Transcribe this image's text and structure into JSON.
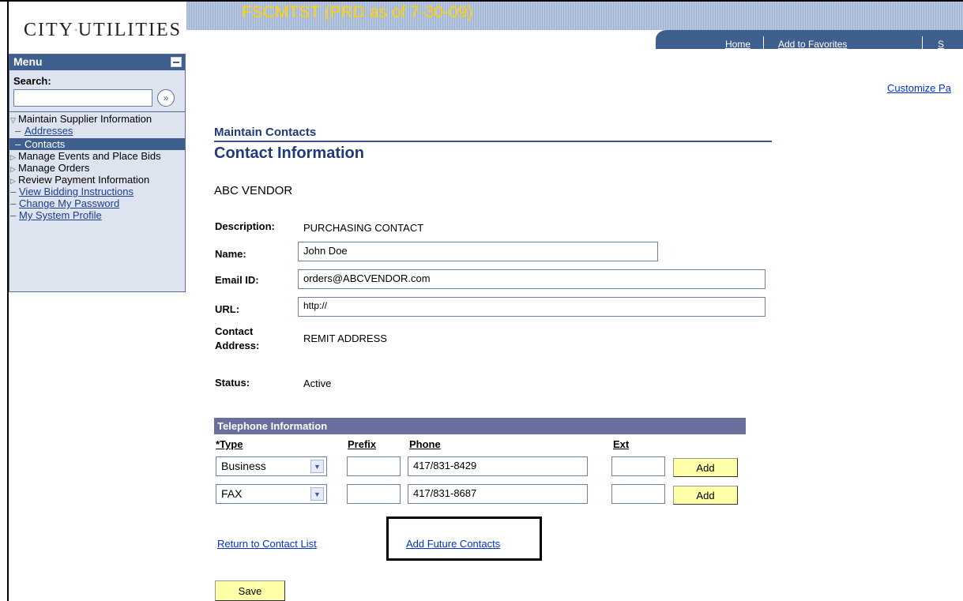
{
  "app": {
    "logo_left": "CITY",
    "logo_right": "UTILITIES",
    "banner_title": "FSCMTST (PRD as of 7-30-09)"
  },
  "nav": {
    "home": "Home",
    "add_favorites": "Add to Favorites"
  },
  "menu": {
    "title": "Menu",
    "search_label": "Search:",
    "search_value": "",
    "items": [
      {
        "label": "Maintain Supplier Information",
        "type": "expanded"
      },
      {
        "label": "Addresses",
        "type": "sub-link"
      },
      {
        "label": "Contacts",
        "type": "sub-active"
      },
      {
        "label": "Manage Events and Place Bids",
        "type": "collapsed"
      },
      {
        "label": "Manage Orders",
        "type": "collapsed"
      },
      {
        "label": "Review Payment Information",
        "type": "collapsed"
      },
      {
        "label": "View Bidding Instructions",
        "type": "link"
      },
      {
        "label": "Change My Password",
        "type": "link"
      },
      {
        "label": "My System Profile",
        "type": "link"
      }
    ]
  },
  "page": {
    "customize": "Customize Pa",
    "breadcrumb": "Maintain Contacts",
    "title": "Contact Information",
    "vendor": "ABC VENDOR"
  },
  "form": {
    "description_label": "Description:",
    "description_value": "PURCHASING CONTACT",
    "name_label": "Name:",
    "name_value": "John Doe",
    "email_label": "Email ID:",
    "email_value": "orders@ABCVENDOR.com",
    "url_label": "URL:",
    "url_value": "http://",
    "address_label_1": "Contact",
    "address_label_2": "Address:",
    "address_value": "REMIT ADDRESS",
    "status_label": "Status:",
    "status_value": "Active"
  },
  "phones": {
    "header": "Telephone Information",
    "columns": [
      "*Type",
      "Prefix",
      "Phone",
      "Ext"
    ],
    "rows": [
      {
        "type": "Business",
        "prefix": "",
        "phone": "417/831-8429",
        "ext": "",
        "add_label": "Add"
      },
      {
        "type": "FAX",
        "prefix": "",
        "phone": "417/831-8687",
        "ext": "",
        "add_label": "Add"
      }
    ]
  },
  "links": {
    "return_list": "Return to Contact List",
    "add_future": "Add Future Contacts"
  },
  "actions": {
    "save": "Save"
  },
  "colors": {
    "header_blue": "#3f5f8f",
    "banner_yellow": "#ffd200",
    "button_yellow": "#ffffa8",
    "grid_header": "#6a6e9c",
    "link_blue": "#0033cc"
  }
}
